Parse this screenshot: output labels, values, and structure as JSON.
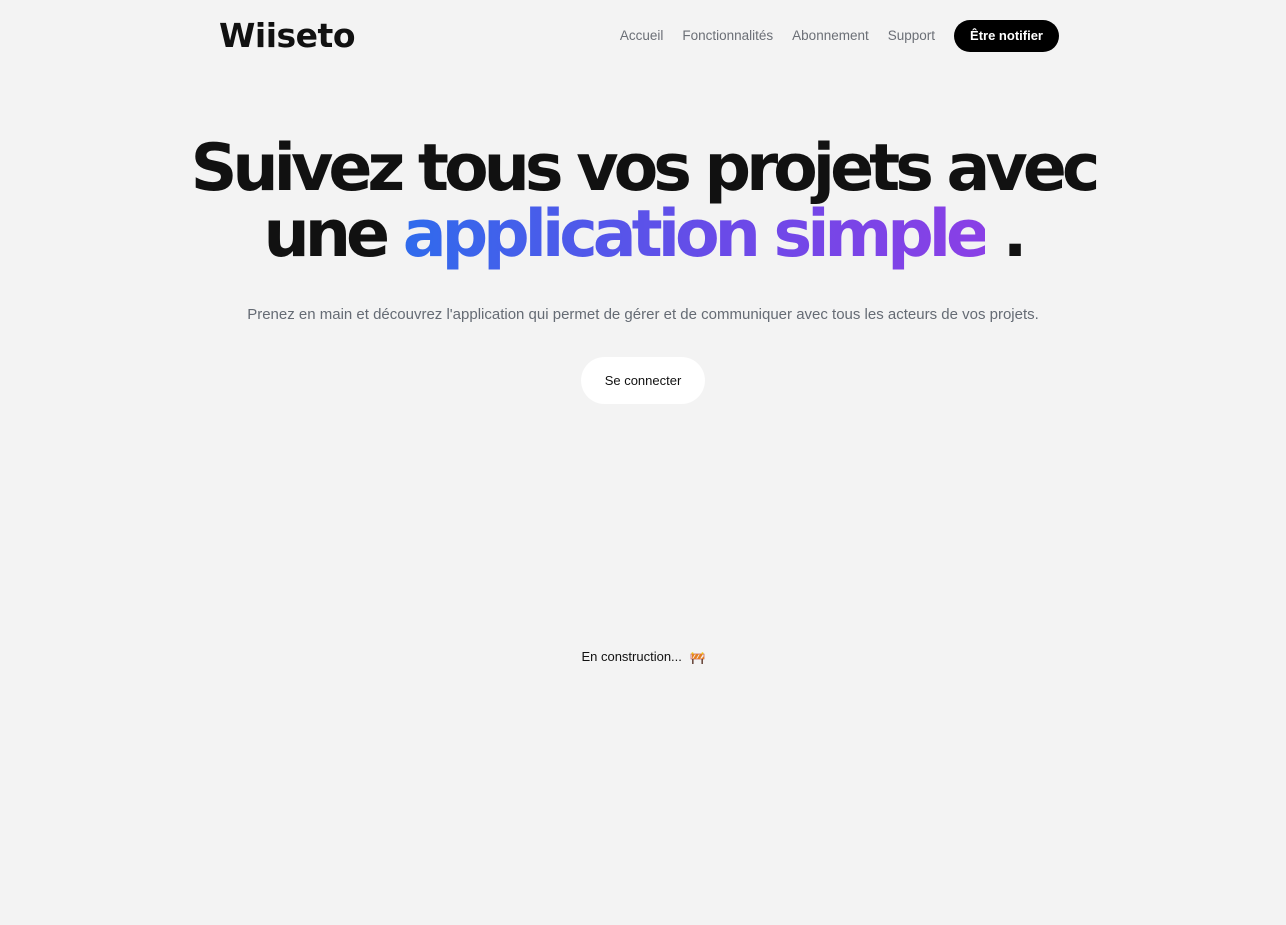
{
  "header": {
    "logo": "Wiiseto",
    "nav": [
      "Accueil",
      "Fonctionnalités",
      "Abonnement",
      "Support"
    ],
    "notify_label": "Être notifier"
  },
  "hero": {
    "headline_line1": "Suivez tous vos projets avec",
    "headline_line2_prefix": "une",
    "headline_highlight": "application simple",
    "headline_suffix": ".",
    "subtitle": "Prenez en main et découvrez l'application qui permet de gérer et de communiquer avec tous les acteurs de vos projets.",
    "cta_label": "Se connecter"
  },
  "status": {
    "text": "En construction...",
    "icon": "construction-barrier-icon"
  },
  "colors": {
    "background": "#f3f3f3",
    "gradient_start": "#2f6bec",
    "gradient_end": "#8a3fe6",
    "notify_button": "#000000"
  }
}
